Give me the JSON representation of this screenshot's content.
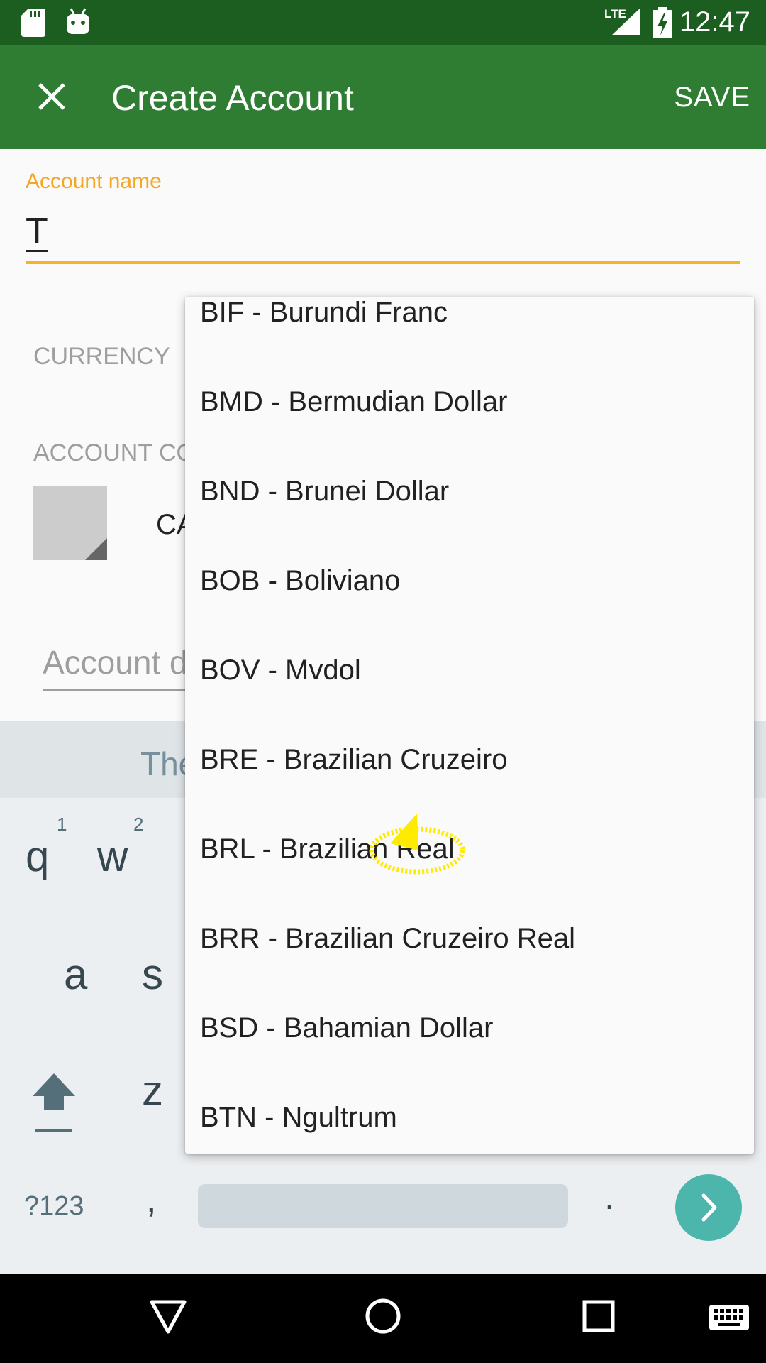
{
  "status_bar": {
    "time": "12:47",
    "network_label": "LTE",
    "icons": [
      "sd-card-icon",
      "android-icon",
      "lte-signal-icon",
      "battery-charging-icon"
    ]
  },
  "app_bar": {
    "close_icon": "close-icon",
    "title": "Create Account",
    "save_label": "SAVE"
  },
  "form": {
    "account_name_label": "Account name",
    "account_name_value": "T",
    "currency_label": "CURRENCY",
    "account_color_label": "ACCOUNT CO",
    "color_value_text": "CA",
    "description_placeholder": "Account d"
  },
  "currency_dropdown": {
    "items": [
      "BIF - Burundi Franc",
      "BMD - Bermudian Dollar",
      "BND - Brunei Dollar",
      "BOB - Boliviano",
      "BOV - Mvdol",
      "BRE - Brazilian Cruzeiro",
      "BRL - Brazilian Real",
      "BRR - Brazilian Cruzeiro Real",
      "BSD - Bahamian Dollar",
      "BTN - Ngultrum"
    ]
  },
  "keyboard": {
    "suggestion": "The",
    "keys": {
      "q": "q",
      "w": "w",
      "a": "a",
      "s": "s",
      "z": "z",
      "hint_1": "1",
      "hint_2": "2",
      "symbols": "?123",
      "comma": ",",
      "period": "."
    }
  },
  "nav_bar": {
    "icons": [
      "back-icon",
      "home-icon",
      "recents-icon",
      "keyboard-icon"
    ]
  },
  "colors": {
    "status_bar": "#1b5e20",
    "app_bar": "#2e7d32",
    "accent": "#f5a623",
    "enter_key": "#4db6ac",
    "tap_indicator": "#ffeb00"
  }
}
